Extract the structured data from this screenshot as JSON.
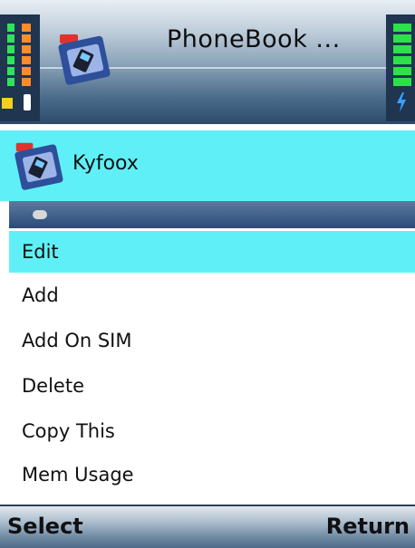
{
  "header": {
    "title": "PhoneBook ...",
    "app_icon": "phonebook-folder-icon",
    "signal_icon": "signal-strength-icon",
    "battery_icon": "battery-icon"
  },
  "contact": {
    "name": "Kyfoox",
    "icon": "contact-folder-icon"
  },
  "menu": {
    "items": [
      {
        "label": "Edit",
        "selected": true
      },
      {
        "label": "Add",
        "selected": false
      },
      {
        "label": "Add On SIM",
        "selected": false
      },
      {
        "label": "Delete",
        "selected": false
      },
      {
        "label": "Copy This",
        "selected": false
      },
      {
        "label": "Mem Usage",
        "selected": false
      }
    ]
  },
  "softkeys": {
    "left": "Select",
    "right": "Return"
  },
  "colors": {
    "highlight": "#5ff0f7",
    "header_dark": "#2c4b6a"
  }
}
